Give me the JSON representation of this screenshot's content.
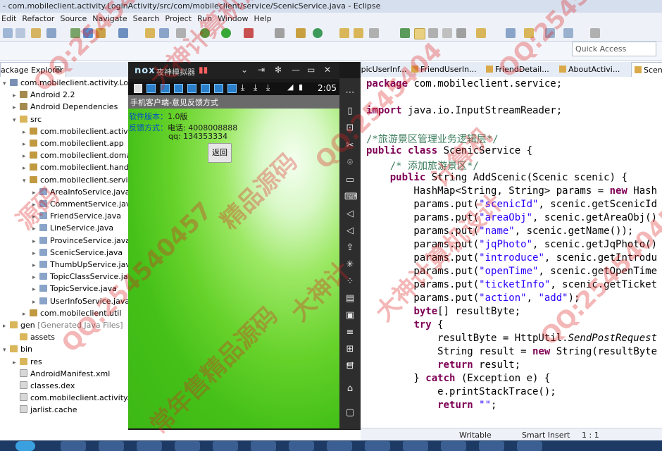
{
  "window": {
    "title": "- com.mobileclient.activity.LoginActivity/src/com/mobileclient/service/ScenicService.java - Eclipse"
  },
  "menu": [
    "Edit",
    "Refactor",
    "Source",
    "Navigate",
    "Search",
    "Project",
    "Run",
    "Window",
    "Help"
  ],
  "quick_access": {
    "placeholder": "Quick Access"
  },
  "package_explorer": {
    "tab_label": "ackage Explorer",
    "close": "☒",
    "items": [
      {
        "label": "com.mobileclient.activity.LoginActi",
        "indent": 0,
        "twisty": "▾",
        "icon": "project"
      },
      {
        "label": "Android 2.2",
        "indent": 1,
        "twisty": "▸",
        "icon": "library"
      },
      {
        "label": "Android Dependencies",
        "indent": 1,
        "twisty": "▸",
        "icon": "library"
      },
      {
        "label": "src",
        "indent": 1,
        "twisty": "▾",
        "icon": "folder"
      },
      {
        "label": "com.mobileclient.activity",
        "indent": 2,
        "twisty": "▸",
        "icon": "package"
      },
      {
        "label": "com.mobileclient.app",
        "indent": 2,
        "twisty": "▸",
        "icon": "package"
      },
      {
        "label": "com.mobileclient.domain",
        "indent": 2,
        "twisty": "▸",
        "icon": "package"
      },
      {
        "label": "com.mobileclient.handler",
        "indent": 2,
        "twisty": "▸",
        "icon": "package"
      },
      {
        "label": "com.mobileclient.service",
        "indent": 2,
        "twisty": "▾",
        "icon": "package"
      },
      {
        "label": "AreaInfoService.java",
        "indent": 3,
        "twisty": "▸",
        "icon": "java"
      },
      {
        "label": "CommentService.java",
        "indent": 3,
        "twisty": "▸",
        "icon": "java"
      },
      {
        "label": "FriendService.java",
        "indent": 3,
        "twisty": "▸",
        "icon": "java"
      },
      {
        "label": "LineService.java",
        "indent": 3,
        "twisty": "▸",
        "icon": "java"
      },
      {
        "label": "ProvinceService.java",
        "indent": 3,
        "twisty": "▸",
        "icon": "java"
      },
      {
        "label": "ScenicService.java",
        "indent": 3,
        "twisty": "▸",
        "icon": "java"
      },
      {
        "label": "ThumbUpService.java",
        "indent": 3,
        "twisty": "▸",
        "icon": "java"
      },
      {
        "label": "TopicClassService.java",
        "indent": 3,
        "twisty": "▸",
        "icon": "java"
      },
      {
        "label": "TopicService.java",
        "indent": 3,
        "twisty": "▸",
        "icon": "java"
      },
      {
        "label": "UserInfoService.java",
        "indent": 3,
        "twisty": "▸",
        "icon": "java"
      },
      {
        "label": "com.mobileclient.util",
        "indent": 2,
        "twisty": "▸",
        "icon": "package"
      },
      {
        "label": "gen",
        "suffix": " [Generated Java Files]",
        "indent": 0,
        "twisty": "▸",
        "icon": "folder"
      },
      {
        "label": "assets",
        "indent": 1,
        "twisty": "",
        "icon": "folder"
      },
      {
        "label": "bin",
        "indent": 0,
        "twisty": "▾",
        "icon": "folder"
      },
      {
        "label": "res",
        "indent": 1,
        "twisty": "▸",
        "icon": "folder"
      },
      {
        "label": "AndroidManifest.xml",
        "indent": 1,
        "twisty": "",
        "icon": "file"
      },
      {
        "label": "classes.dex",
        "indent": 1,
        "twisty": "",
        "icon": "file"
      },
      {
        "label": "com.mobileclient.activity.Lo",
        "indent": 1,
        "twisty": "",
        "icon": "file"
      },
      {
        "label": "jarlist.cache",
        "indent": 1,
        "twisty": "",
        "icon": "file"
      }
    ]
  },
  "editor_tabs": [
    {
      "label": "TopicUserInf..."
    },
    {
      "label": "FriendUserIn..."
    },
    {
      "label": "FriendDetail..."
    },
    {
      "label": "AboutActivi..."
    },
    {
      "label": "Sceni"
    }
  ],
  "code": [
    {
      "tokens": [
        {
          "t": "package",
          "c": "kw"
        },
        {
          "t": " com.mobileclient.service;",
          "c": ""
        }
      ]
    },
    {
      "tokens": []
    },
    {
      "tokens": [
        {
          "t": "import",
          "c": "kw"
        },
        {
          "t": " java.io.InputStreamReader;",
          "c": ""
        }
      ]
    },
    {
      "tokens": []
    },
    {
      "tokens": [
        {
          "t": "/*旅游景区管理业务逻辑层*/",
          "c": "cmt"
        }
      ]
    },
    {
      "tokens": [
        {
          "t": "public",
          "c": "kw"
        },
        {
          "t": " ",
          "c": ""
        },
        {
          "t": "class",
          "c": "kw"
        },
        {
          "t": " ScenicService {",
          "c": ""
        }
      ]
    },
    {
      "tokens": [
        {
          "t": "    /* 添加旅游景区*/",
          "c": "cmt"
        }
      ]
    },
    {
      "tokens": [
        {
          "t": "    ",
          "c": ""
        },
        {
          "t": "public",
          "c": "kw"
        },
        {
          "t": " String AddScenic(Scenic scenic) {",
          "c": ""
        }
      ]
    },
    {
      "tokens": [
        {
          "t": "        HashMap<String, String> params = ",
          "c": ""
        },
        {
          "t": "new",
          "c": "kw"
        },
        {
          "t": " Hash",
          "c": ""
        }
      ]
    },
    {
      "tokens": [
        {
          "t": "        params.put(",
          "c": ""
        },
        {
          "t": "\"scenicId\"",
          "c": "str"
        },
        {
          "t": ", scenic.getScenicId",
          "c": ""
        }
      ]
    },
    {
      "tokens": [
        {
          "t": "        params.put(",
          "c": ""
        },
        {
          "t": "\"areaObj\"",
          "c": "str"
        },
        {
          "t": ", scenic.getAreaObj()",
          "c": ""
        }
      ]
    },
    {
      "tokens": [
        {
          "t": "        params.put(",
          "c": ""
        },
        {
          "t": "\"name\"",
          "c": "str"
        },
        {
          "t": ", scenic.getName());",
          "c": ""
        }
      ]
    },
    {
      "tokens": [
        {
          "t": "        params.put(",
          "c": ""
        },
        {
          "t": "\"jqPhoto\"",
          "c": "str"
        },
        {
          "t": ", scenic.getJqPhoto()",
          "c": ""
        }
      ]
    },
    {
      "tokens": [
        {
          "t": "        params.put(",
          "c": ""
        },
        {
          "t": "\"introduce\"",
          "c": "str"
        },
        {
          "t": ", scenic.getIntrodu",
          "c": ""
        }
      ]
    },
    {
      "tokens": [
        {
          "t": "        params.put(",
          "c": ""
        },
        {
          "t": "\"openTime\"",
          "c": "str"
        },
        {
          "t": ", scenic.getOpenTime",
          "c": ""
        }
      ]
    },
    {
      "tokens": [
        {
          "t": "        params.put(",
          "c": ""
        },
        {
          "t": "\"ticketInfo\"",
          "c": "str"
        },
        {
          "t": ", scenic.getTicket",
          "c": ""
        }
      ]
    },
    {
      "tokens": [
        {
          "t": "        params.put(",
          "c": ""
        },
        {
          "t": "\"action\"",
          "c": "str"
        },
        {
          "t": ", ",
          "c": ""
        },
        {
          "t": "\"add\"",
          "c": "str"
        },
        {
          "t": ");",
          "c": ""
        }
      ]
    },
    {
      "tokens": [
        {
          "t": "        ",
          "c": ""
        },
        {
          "t": "byte",
          "c": "kw"
        },
        {
          "t": "[] resultByte;",
          "c": ""
        }
      ]
    },
    {
      "tokens": [
        {
          "t": "        ",
          "c": ""
        },
        {
          "t": "try",
          "c": "kw"
        },
        {
          "t": " {",
          "c": ""
        }
      ]
    },
    {
      "tokens": [
        {
          "t": "            resultByte = HttpUtil.",
          "c": ""
        },
        {
          "t": "SendPostRequest",
          "c": "italic"
        }
      ]
    },
    {
      "tokens": [
        {
          "t": "            String result = ",
          "c": ""
        },
        {
          "t": "new",
          "c": "kw"
        },
        {
          "t": " String(resultByte",
          "c": ""
        }
      ]
    },
    {
      "tokens": [
        {
          "t": "            ",
          "c": ""
        },
        {
          "t": "return",
          "c": "kw"
        },
        {
          "t": " result;",
          "c": ""
        }
      ]
    },
    {
      "tokens": [
        {
          "t": "        } ",
          "c": ""
        },
        {
          "t": "catch",
          "c": "kw"
        },
        {
          "t": " (Exception e) {",
          "c": ""
        }
      ]
    },
    {
      "tokens": [
        {
          "t": "            e.printStackTrace();",
          "c": ""
        }
      ]
    },
    {
      "tokens": [
        {
          "t": "            ",
          "c": ""
        },
        {
          "t": "return",
          "c": "kw"
        },
        {
          "t": " ",
          "c": ""
        },
        {
          "t": "\"\"",
          "c": "str"
        },
        {
          "t": ";",
          "c": ""
        }
      ]
    }
  ],
  "emulator": {
    "logo": "nox",
    "name": "夜神模拟器",
    "time": "2:05",
    "app_title": "手机客户端-意见反馈方式",
    "version_label": "软件版本：",
    "version_value": "1.0版",
    "feedback_label": "反馈方式：",
    "phone": "电话: 4008008888",
    "qq": "qq: 134353334",
    "back_button": "返回"
  },
  "statusbar": {
    "mode": "Writable",
    "insert": "Smart Insert",
    "position": "1 : 1"
  },
  "watermarks": [
    "QQ:254540457",
    "大神计算机设计",
    "源码",
    "QQ:2545404",
    "精品源码",
    "计算机",
    "QQ:2545404",
    "QQ:254540457",
    "大神计算机设计",
    "常年售精品源码",
    "QQ:254540457",
    "大神计"
  ]
}
